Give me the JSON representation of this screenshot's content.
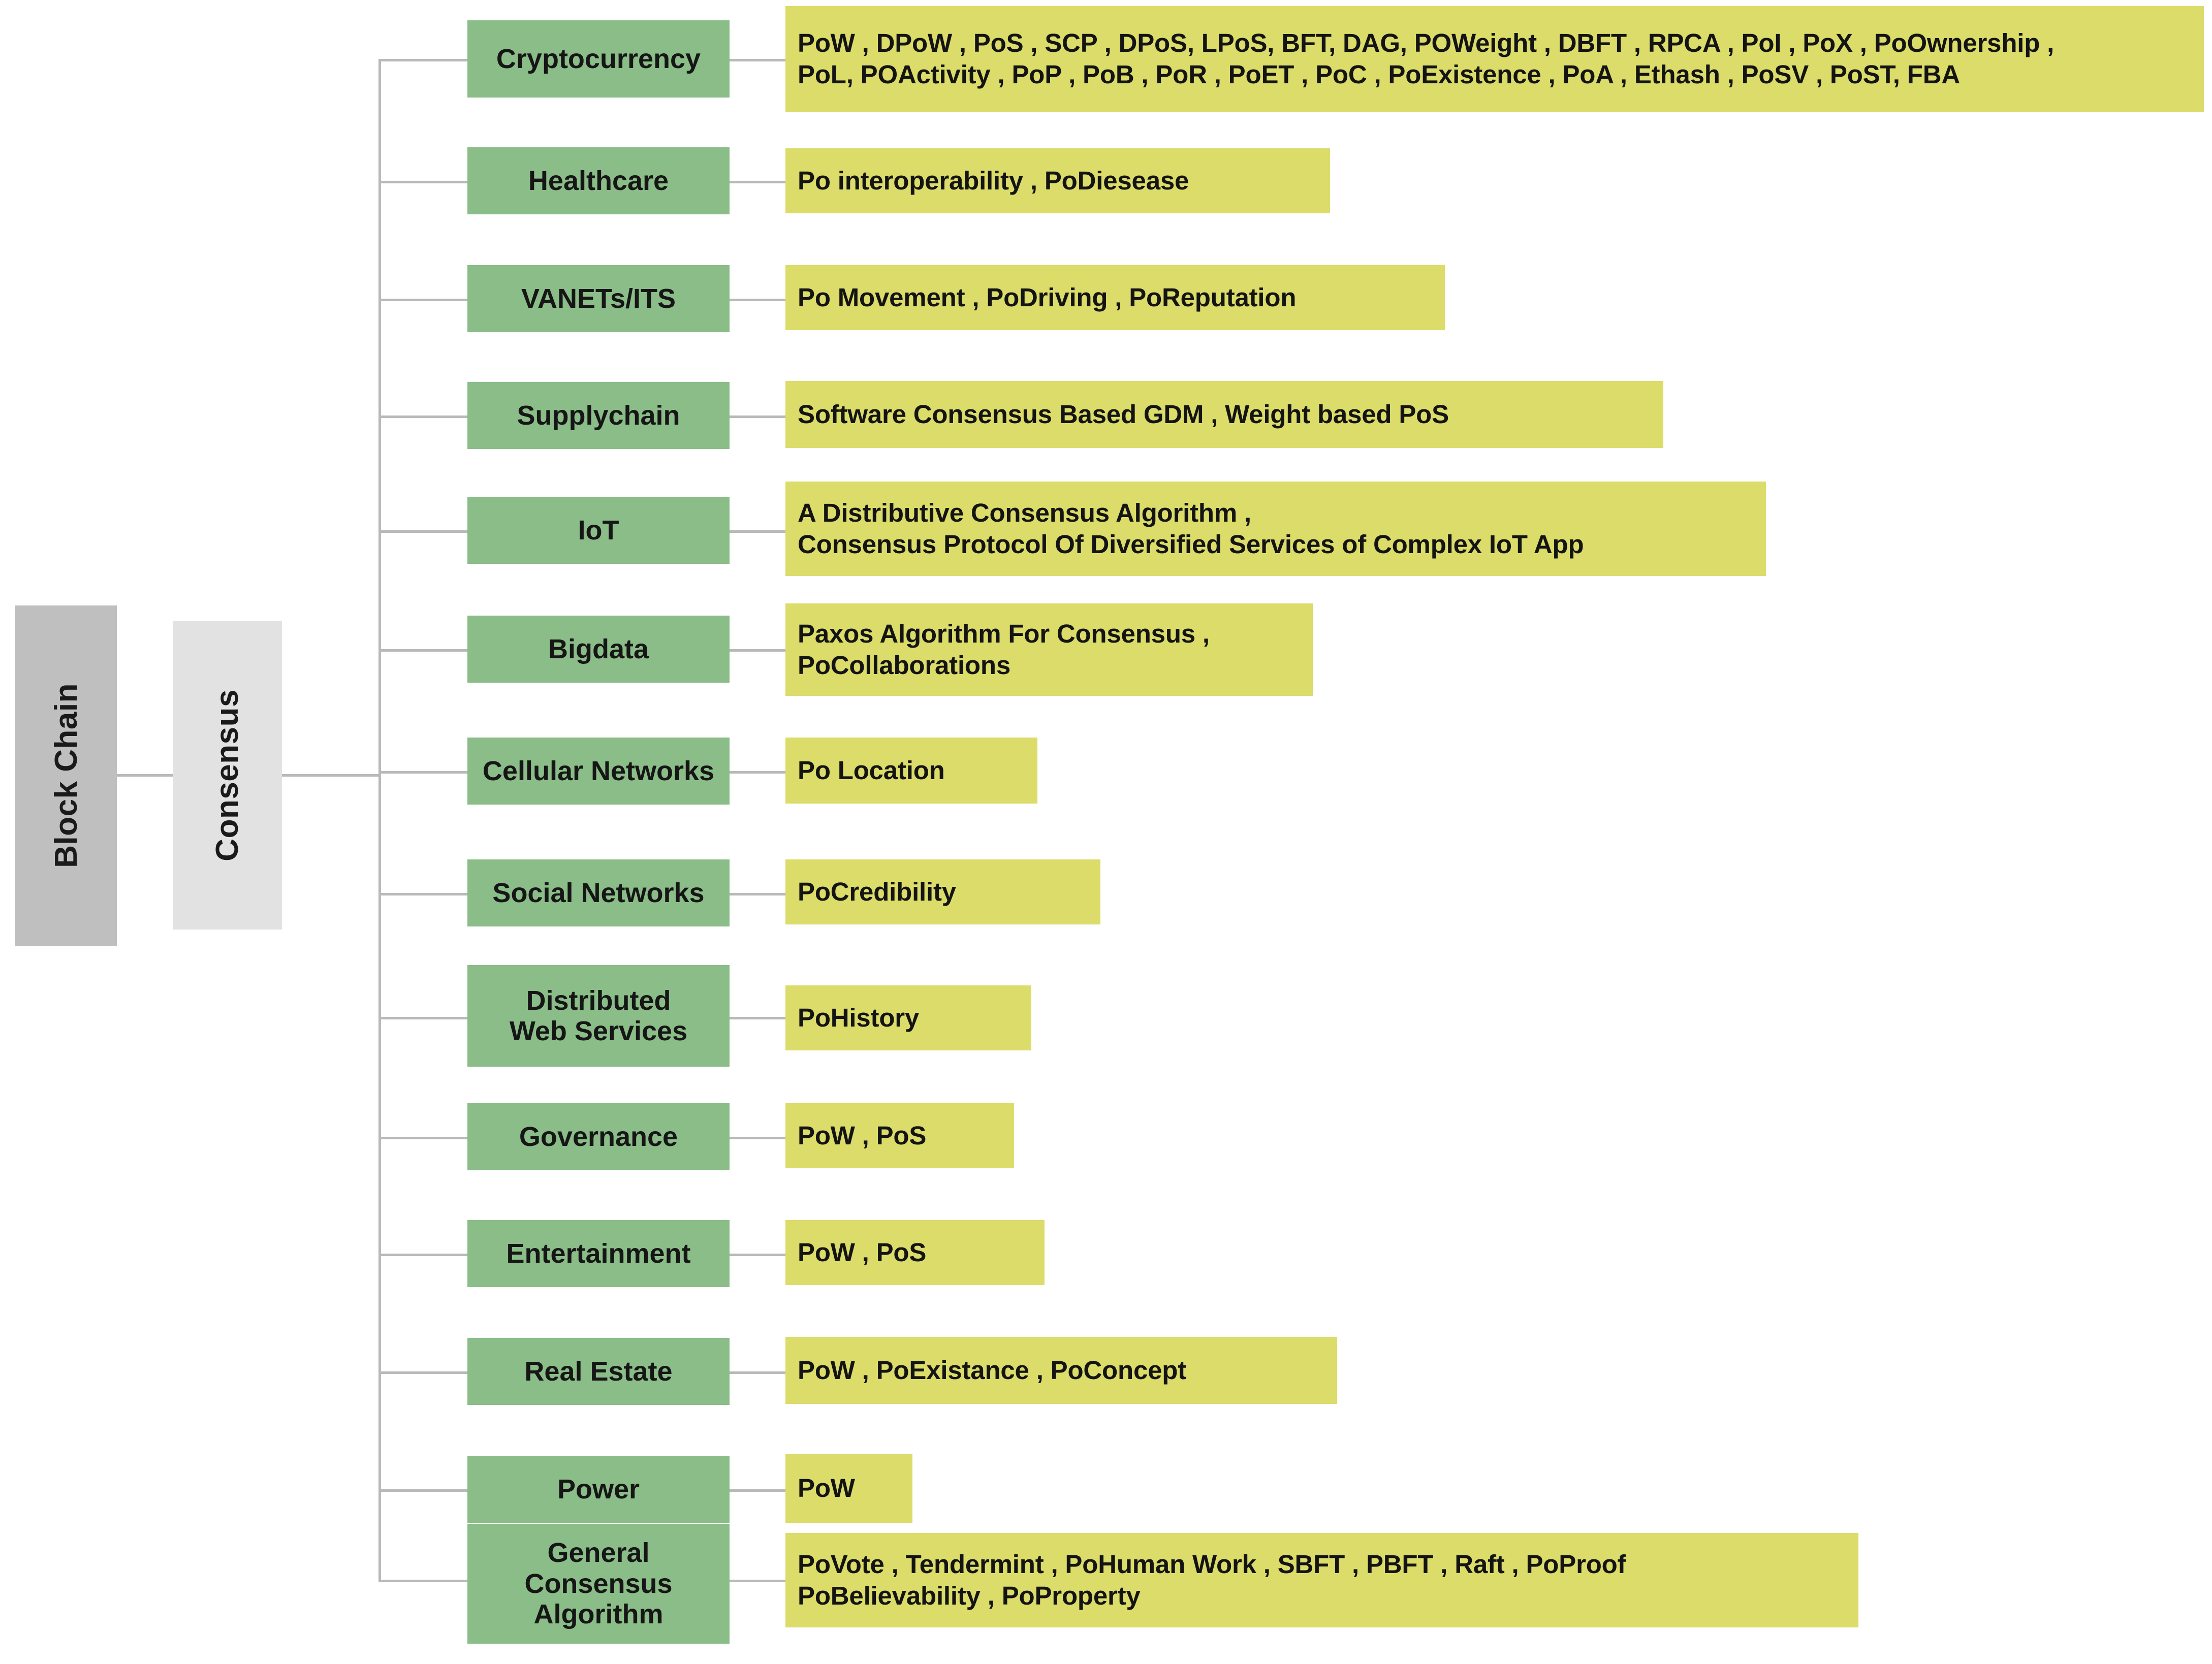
{
  "root": {
    "primary": {
      "label": "Block Chain",
      "color": "#bfbfbf"
    },
    "secondary": {
      "label": "Consensus",
      "color": "#e2e2e2"
    }
  },
  "colors": {
    "category_box": "#8abd87",
    "algorithm_box": "#dbdc69",
    "connector_line": "#b9b9b9",
    "text": "#141414",
    "background": "#ffffff"
  },
  "branches": [
    {
      "category": "Cryptocurrency",
      "algorithms": "PoW , DPoW , PoS , SCP , DPoS, LPoS, BFT, DAG, POWeight , DBFT , RPCA , PoI , PoX , PoOwnership ,\nPoL, POActivity , PoP , PoB , PoR , PoET , PoC , PoExistence , PoA , Ethash , PoSV , PoST, FBA"
    },
    {
      "category": "Healthcare",
      "algorithms": "Po interoperability , PoDiesease"
    },
    {
      "category": "VANETs/ITS",
      "algorithms": "Po Movement , PoDriving , PoReputation"
    },
    {
      "category": "Supplychain",
      "algorithms": "Software Consensus Based GDM , Weight based PoS"
    },
    {
      "category": "IoT",
      "algorithms": "A Distributive Consensus Algorithm      ,\nConsensus Protocol Of Diversified Services of Complex IoT App"
    },
    {
      "category": "Bigdata",
      "algorithms": "Paxos Algorithm For Consensus ,\nPoCollaborations"
    },
    {
      "category": "Cellular Networks",
      "algorithms": "Po Location"
    },
    {
      "category": "Social Networks",
      "algorithms": "PoCredibility"
    },
    {
      "category": "Distributed\nWeb Services",
      "algorithms": "PoHistory"
    },
    {
      "category": "Governance",
      "algorithms": "PoW , PoS"
    },
    {
      "category": "Entertainment",
      "algorithms": "PoW , PoS"
    },
    {
      "category": "Real Estate",
      "algorithms": "PoW , PoExistance  ,  PoConcept"
    },
    {
      "category": "Power",
      "algorithms": "PoW"
    },
    {
      "category": "General\nConsensus\nAlgorithm",
      "algorithms": "PoVote , Tendermint , PoHuman Work , SBFT , PBFT , Raft , PoProof\nPoBelievability , PoProperty"
    }
  ]
}
